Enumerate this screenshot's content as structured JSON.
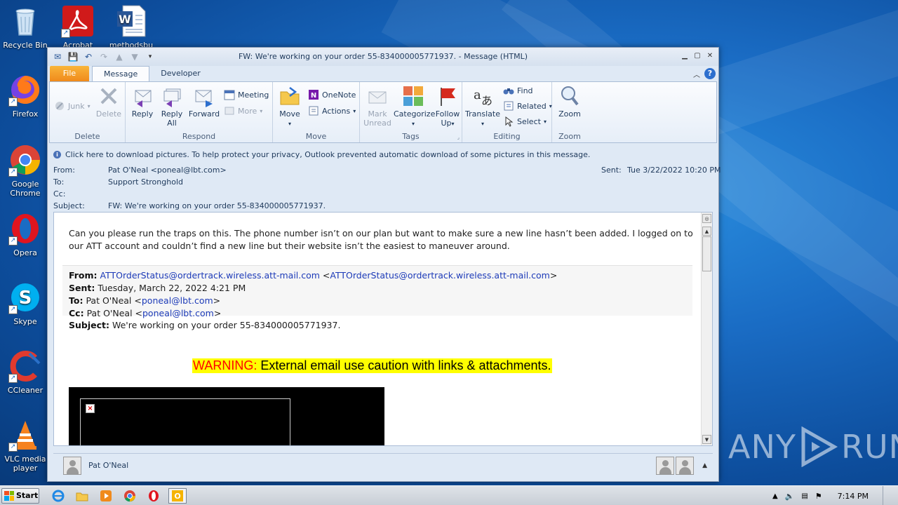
{
  "desktop": {
    "icons": [
      {
        "label": "Recycle Bin",
        "icon": "recycle-bin-icon"
      },
      {
        "label": "Acrobat",
        "icon": "acrobat-icon"
      },
      {
        "label": "methodsbu",
        "icon": "word-document-icon"
      },
      {
        "label": "Firefox",
        "icon": "firefox-icon"
      },
      {
        "label": "Google Chrome",
        "icon": "chrome-icon"
      },
      {
        "label": "Opera",
        "icon": "opera-icon"
      },
      {
        "label": "Skype",
        "icon": "skype-icon"
      },
      {
        "label": "CCleaner",
        "icon": "ccleaner-icon"
      },
      {
        "label": "VLC media player",
        "icon": "vlc-icon"
      }
    ],
    "watermark": "ANY RUN"
  },
  "window": {
    "title": "FW: We're working on your order 55-834000005771937. - Message (HTML)",
    "tabs": {
      "file": "File",
      "message": "Message",
      "developer": "Developer"
    }
  },
  "ribbon": {
    "delete_group": {
      "label": "Delete",
      "junk": "Junk",
      "delete": "Delete"
    },
    "respond_group": {
      "label": "Respond",
      "reply": "Reply",
      "reply_all_1": "Reply",
      "reply_all_2": "All",
      "forward": "Forward",
      "meeting": "Meeting",
      "more": "More"
    },
    "move_group": {
      "label": "Move",
      "move": "Move",
      "onenote": "OneNote",
      "actions": "Actions"
    },
    "tags_group": {
      "label": "Tags",
      "mark_unread_1": "Mark",
      "mark_unread_2": "Unread",
      "categorize": "Categorize",
      "follow_up_1": "Follow",
      "follow_up_2": "Up"
    },
    "editing_group": {
      "label": "Editing",
      "translate": "Translate",
      "find": "Find",
      "related": "Related",
      "select": "Select"
    },
    "zoom_group": {
      "label": "Zoom",
      "zoom": "Zoom"
    }
  },
  "message": {
    "infobar": "Click here to download pictures. To help protect your privacy, Outlook prevented automatic download of some pictures in this message.",
    "from_label": "From:",
    "from": "Pat O'Neal <poneal@lbt.com>",
    "to_label": "To:",
    "to": "Support Stronghold",
    "cc_label": "Cc:",
    "subject_label": "Subject:",
    "subject": "FW: We're working on your order 55-834000005771937.",
    "sent_label": "Sent:",
    "sent": "Tue 3/22/2022 10:20 PM"
  },
  "body": {
    "line1": "Can you please run the traps on this.  The phone number isn’t on our plan but want to make sure a new line hasn’t been added.  I logged on to",
    "line2": "our ATT account and couldn’t find a new line but their website isn’t the easiest to maneuver around.",
    "fwd": {
      "from_label": "From:",
      "from_link": "ATTOrderStatus@ordertrack.wireless.att-mail.com",
      "from_link2": "ATTOrderStatus@ordertrack.wireless.att-mail.com",
      "sent_label": "Sent:",
      "sent": "Tuesday, March 22, 2022 4:21 PM",
      "to_label": "To:",
      "to_name": "Pat O'Neal",
      "to_link": "poneal@lbt.com",
      "cc_label": "Cc:",
      "cc_name": "Pat O'Neal",
      "cc_link": "poneal@lbt.com",
      "subject_label": "Subject:",
      "subject": "We're working on your order 55-834000005771937."
    },
    "warning_red": "WARNING:",
    "warning_black": "External email use caution with links & attachments."
  },
  "people_pane": {
    "name": "Pat O'Neal"
  },
  "taskbar": {
    "start": "Start",
    "clock": "7:14 PM"
  }
}
